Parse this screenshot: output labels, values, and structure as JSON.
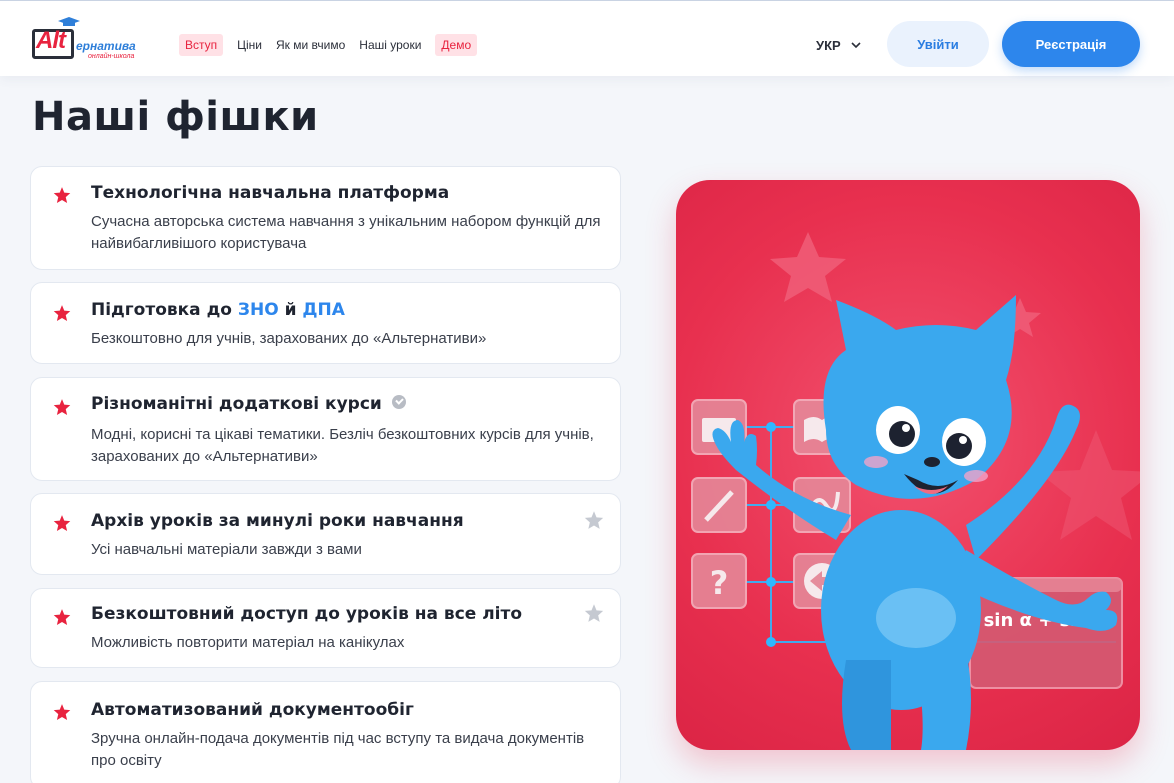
{
  "header": {
    "logo": {
      "alt_text": "Alt",
      "rest_text": "ернатива",
      "sub_text": "онлайн-школа"
    },
    "nav": [
      {
        "label": "Вступ",
        "highlight": true
      },
      {
        "label": "Ціни",
        "highlight": false
      },
      {
        "label": "Як ми вчимо",
        "highlight": false
      },
      {
        "label": "Наші уроки",
        "highlight": false
      },
      {
        "label": "Демо",
        "highlight": true
      }
    ],
    "language": "УКР",
    "login_label": "Увійти",
    "register_label": "Реєстрація"
  },
  "page_title": "Наші фішки",
  "features": [
    {
      "title": "Технологічна навчальна платформа",
      "description": "Сучасна авторська система навчання з унікальним набором функцій для найвибагливішого користувача"
    },
    {
      "title_prefix": "Підготовка до ",
      "title_link1": "ЗНО",
      "title_mid": " й ",
      "title_link2": "ДПА",
      "description": "Безкоштовно для учнів, зарахованих до «Альтернативи»"
    },
    {
      "title": "Різноманітні додаткові курси",
      "description": "Модні, корисні та цікаві тематики. Безліч безкоштовних курсів для учнів, зарахованих до «Альтернативи»"
    },
    {
      "title": "Архів уроків за минулі роки навчання",
      "description": "Усі навчальні матеріали завжди з вами"
    },
    {
      "title": "Безкоштовний доступ до уроків на все літо",
      "description": "Можливість повторити матеріал на канікулах"
    },
    {
      "title": "Автоматизований документообіг",
      "description": "Зручна онлайн-подача документів під час вступу та видача документів про освіту"
    }
  ],
  "illustration": {
    "formula": "sin α + sin β",
    "question_mark": "?"
  },
  "colors": {
    "accent_red": "#e8233f",
    "accent_blue": "#2d86ec",
    "promo_bg": "#e8304f"
  }
}
